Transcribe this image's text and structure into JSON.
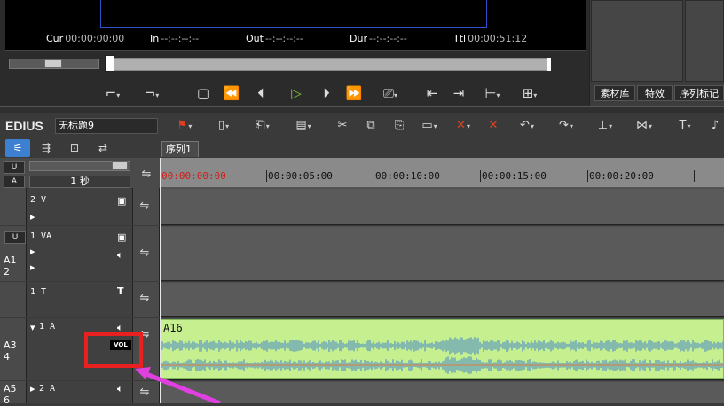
{
  "preview": {
    "cur_label": "Cur",
    "cur_value": "00:00:00:00",
    "in_label": "In",
    "in_value": "--:--:--:--",
    "out_label": "Out",
    "out_value": "--:--:--:--",
    "dur_label": "Dur",
    "dur_value": "--:--:--:--",
    "ttl_label": "Ttl",
    "ttl_value": "00:00:51:12"
  },
  "transport": {
    "icons": [
      "set-in-icon",
      "set-out-icon",
      "stop-icon",
      "rewind-icon",
      "step-back-icon",
      "play-icon",
      "step-forward-icon",
      "fast-forward-icon",
      "loop-icon",
      "insert-icon",
      "overwrite-icon",
      "split-icon",
      "output-icon"
    ]
  },
  "right_panel": {
    "tabs": [
      "素材库",
      "特效",
      "序列标记"
    ]
  },
  "timeline": {
    "app_name": "EDIUS",
    "project_name": "无标题9",
    "sequence_tab": "序列1",
    "zoom_value": "1 秒",
    "ruler_labels": [
      "00:00:00:00",
      "00:00:05:00",
      "00:00:10:00",
      "00:00:15:00",
      "00:00:20:00"
    ]
  },
  "tracks": [
    {
      "left": "",
      "name": "2 V"
    },
    {
      "left": "A1 2",
      "name": "1 VA"
    },
    {
      "left": "",
      "name": "1 T"
    },
    {
      "left": "A3 4",
      "name": "1 A"
    },
    {
      "left": "A5 6",
      "name": "2 A"
    }
  ],
  "clip": {
    "label": "A16",
    "color": "#c6f090"
  },
  "vol_label": "VOL",
  "annotation": {
    "highlight_color": "#e82020",
    "arrow_color": "#e040e0"
  }
}
